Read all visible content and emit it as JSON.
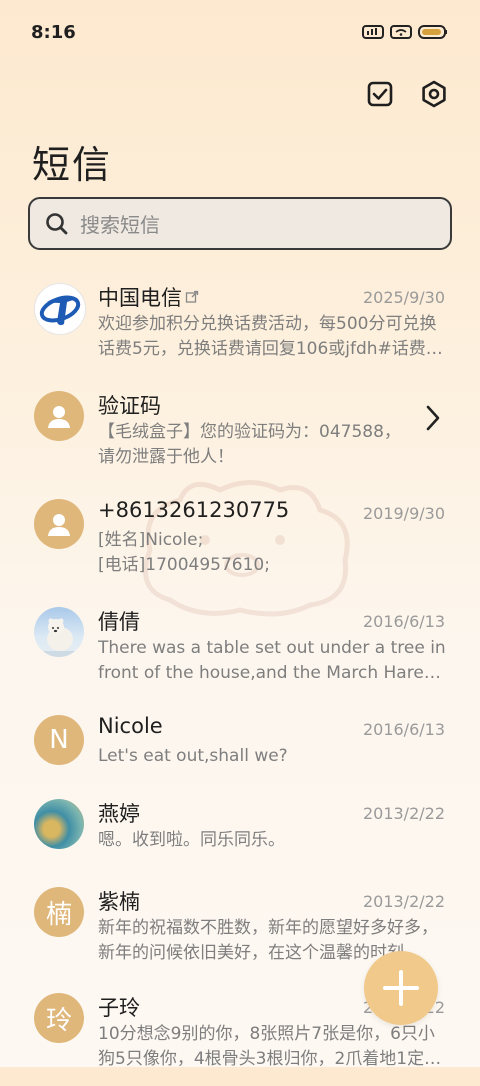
{
  "status_bar": {
    "time": "8:16"
  },
  "header": {
    "title": "短信"
  },
  "search": {
    "placeholder": "搜索短信"
  },
  "messages": [
    {
      "name": "中国电信",
      "date": "2025/9/30",
      "preview": "欢迎参加积分兑换话费活动，每500分可兑换话费5元，兑换话费请回复106或jfdh#话费…",
      "avatar": "logo",
      "avatar_text": ""
    },
    {
      "name": "验证码",
      "date": "",
      "preview": "【毛绒盒子】您的验证码为：047588，请勿泄露于他人！",
      "avatar": "person",
      "avatar_text": ""
    },
    {
      "name": "+8613261230775",
      "date": "2019/9/30",
      "preview": "[姓名]Nicole;\n[电话]17004957610;",
      "avatar": "person",
      "avatar_text": ""
    },
    {
      "name": "倩倩",
      "date": "2016/6/13",
      "preview": "There was a table set out under a tree in front of the house,and the March Hare an…",
      "avatar": "photo-bear",
      "avatar_text": ""
    },
    {
      "name": "Nicole",
      "date": "2016/6/13",
      "preview": "Let's eat out,shall we?",
      "avatar": "letter",
      "avatar_text": "N"
    },
    {
      "name": "燕婷",
      "date": "2013/2/22",
      "preview": "嗯。收到啦。同乐同乐。",
      "avatar": "photo-sea",
      "avatar_text": ""
    },
    {
      "name": "紫楠",
      "date": "2013/2/22",
      "preview": "新年的祝福数不胜数，新年的愿望好多好多，新年的问候依旧美好，在这个温馨的时刻…",
      "avatar": "letter",
      "avatar_text": "楠"
    },
    {
      "name": "子玲",
      "date": "2013/2/22",
      "preview": "10分想念9别的你，8张照片7张是你，6只小狗5只像你，4根骨头3根归你，2爪着地1定…",
      "avatar": "letter",
      "avatar_text": "玲"
    }
  ],
  "colors": {
    "accent": "#dfb77a",
    "fab": "#f0c98b"
  }
}
